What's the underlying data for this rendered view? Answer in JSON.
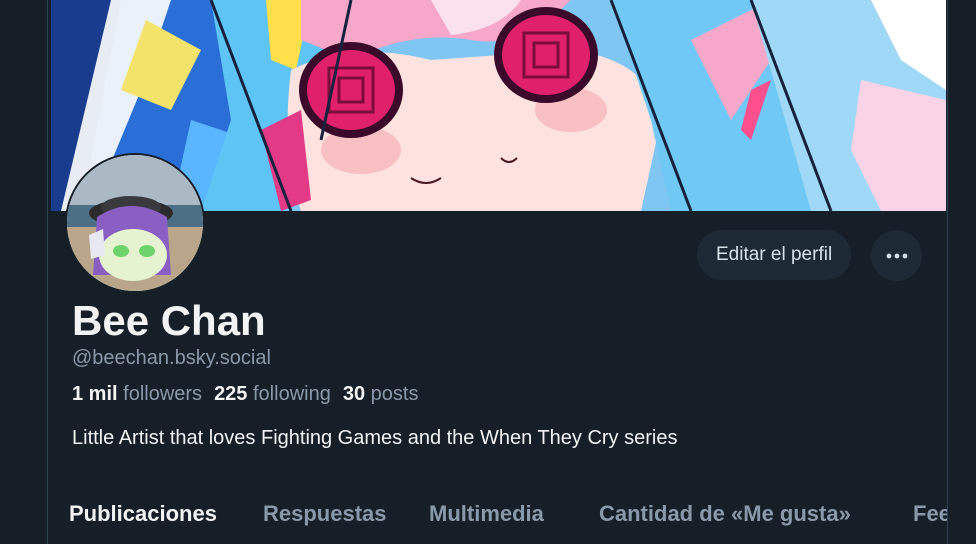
{
  "profile": {
    "display_name": "Bee Chan",
    "handle": "@beechan.bsky.social",
    "bio": "Little Artist that loves Fighting Games and the When They Cry series",
    "stats": {
      "followers_count": "1 mil",
      "followers_label": "followers",
      "following_count": "225",
      "following_label": "following",
      "posts_count": "30",
      "posts_label": "posts"
    }
  },
  "actions": {
    "edit_profile_label": "Editar el perfil",
    "more_icon": "ellipsis-icon"
  },
  "tabs": [
    {
      "label": "Publicaciones",
      "active": true
    },
    {
      "label": "Respuestas",
      "active": false
    },
    {
      "label": "Multimedia",
      "active": false
    },
    {
      "label": "Cantidad de «Me gusta»",
      "active": false
    },
    {
      "label": "Fee",
      "active": false
    }
  ],
  "colors": {
    "background": "#161e27",
    "button_bg": "#1e2936",
    "text_primary": "#f1f3f5",
    "text_secondary": "#8a99a9"
  }
}
